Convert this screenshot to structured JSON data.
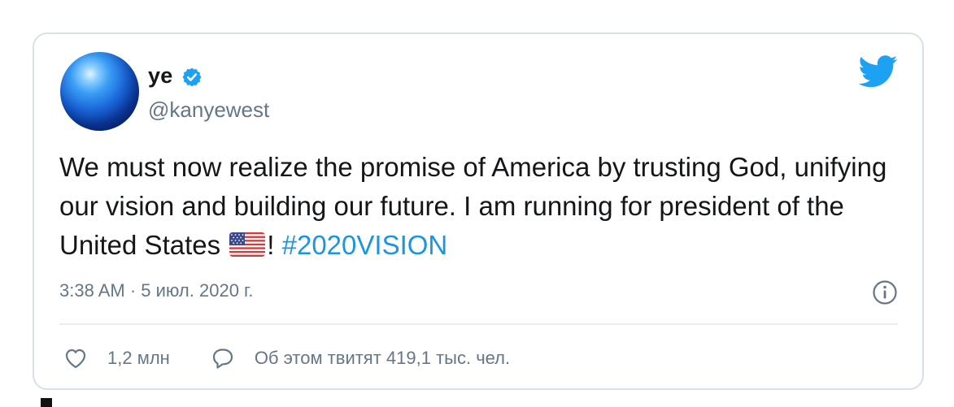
{
  "tweet": {
    "display_name": "ye",
    "handle": "@kanyewest",
    "text_before_flag": "We must now realize the promise of America by trusting God, unifying our vision and building our future. I am running for president of the United States ",
    "text_after_flag": "! ",
    "hashtag": "#2020VISION",
    "timestamp": "3:38 AM · 5 июл. 2020 г.",
    "like_count": "1,2 млн",
    "discussion_text": "Об этом твитят 419,1 тыс. чел."
  },
  "colors": {
    "twitter_blue": "#1da1f2",
    "hashtag_blue": "#1b95e0",
    "secondary_text": "#657786",
    "primary_text": "#14171a"
  },
  "icons": {
    "verified": "verified-badge-icon",
    "bird": "twitter-bird-icon",
    "info": "info-icon",
    "like": "heart-icon",
    "reply": "speech-bubble-icon",
    "flag": "us-flag-icon"
  }
}
